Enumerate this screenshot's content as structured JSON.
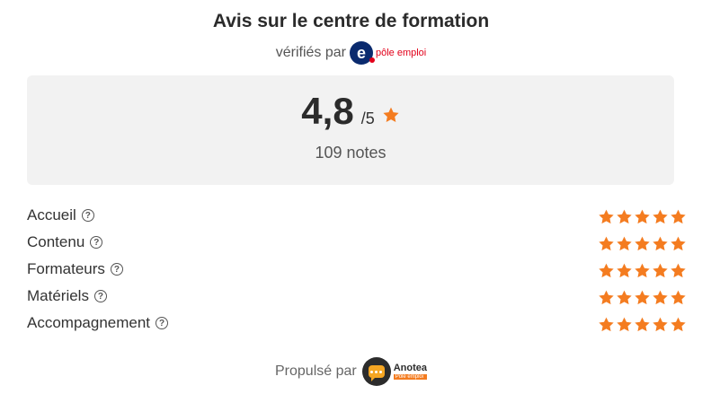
{
  "header": {
    "title": "Avis sur le centre de formation",
    "verified_label": "vérifiés par",
    "verified_logo_letter": "e",
    "verified_logo_text": "pôle emploi"
  },
  "summary": {
    "score": "4,8",
    "out_of": "/5",
    "count_label": "109 notes"
  },
  "criteria": [
    {
      "label": "Accueil",
      "icon": "help-circle-icon",
      "rating": 5
    },
    {
      "label": "Contenu",
      "icon": "help-circle-icon",
      "rating": 5
    },
    {
      "label": "Formateurs",
      "icon": "help-circle-icon",
      "rating": 5
    },
    {
      "label": "Matériels",
      "icon": "help-circle-icon",
      "rating": 5
    },
    {
      "label": "Accompagnement",
      "icon": "help-circle-icon",
      "rating": 5
    }
  ],
  "footer": {
    "powered_label": "Propulsé par",
    "brand_name": "Anotea",
    "brand_sub": "Pôle emploi"
  },
  "colors": {
    "star": "#f47c20",
    "panel": "#f2f2f2"
  }
}
